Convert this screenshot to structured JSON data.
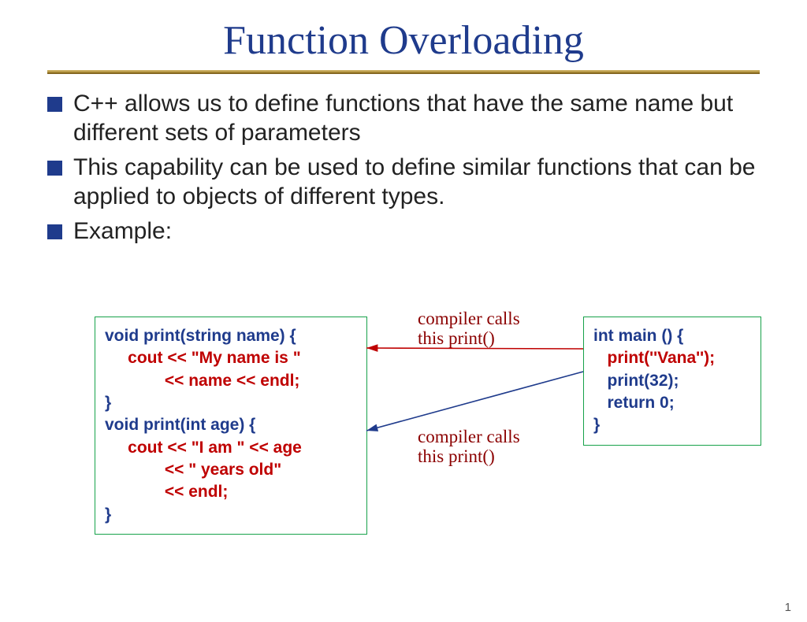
{
  "title": "Function Overloading",
  "bullets": [
    "C++ allows us to define functions that have the same name but different sets of parameters",
    "This capability can be used to define similar functions that can be applied to objects of different types.",
    "Example:"
  ],
  "left_code": {
    "l1": "void print(string name) {",
    "l2": "     cout << \"My name is \"",
    "l3": "             << name << endl;",
    "l4": "}",
    "l5": "void print(int age) {",
    "l6": "     cout << \"I am \" << age",
    "l7": "             << \" years old\"",
    "l8": "             << endl;",
    "l9": "}"
  },
  "right_code": {
    "l1": "int main () {",
    "l2": "   print(''Vana'');",
    "l3": "   print(32);",
    "l4": "   return 0;",
    "l5": "}"
  },
  "annotations": {
    "ann1_line1": "compiler calls",
    "ann1_line2": "this print()",
    "ann2_line1": "compiler calls",
    "ann2_line2": "this print()"
  },
  "page_number": "1"
}
